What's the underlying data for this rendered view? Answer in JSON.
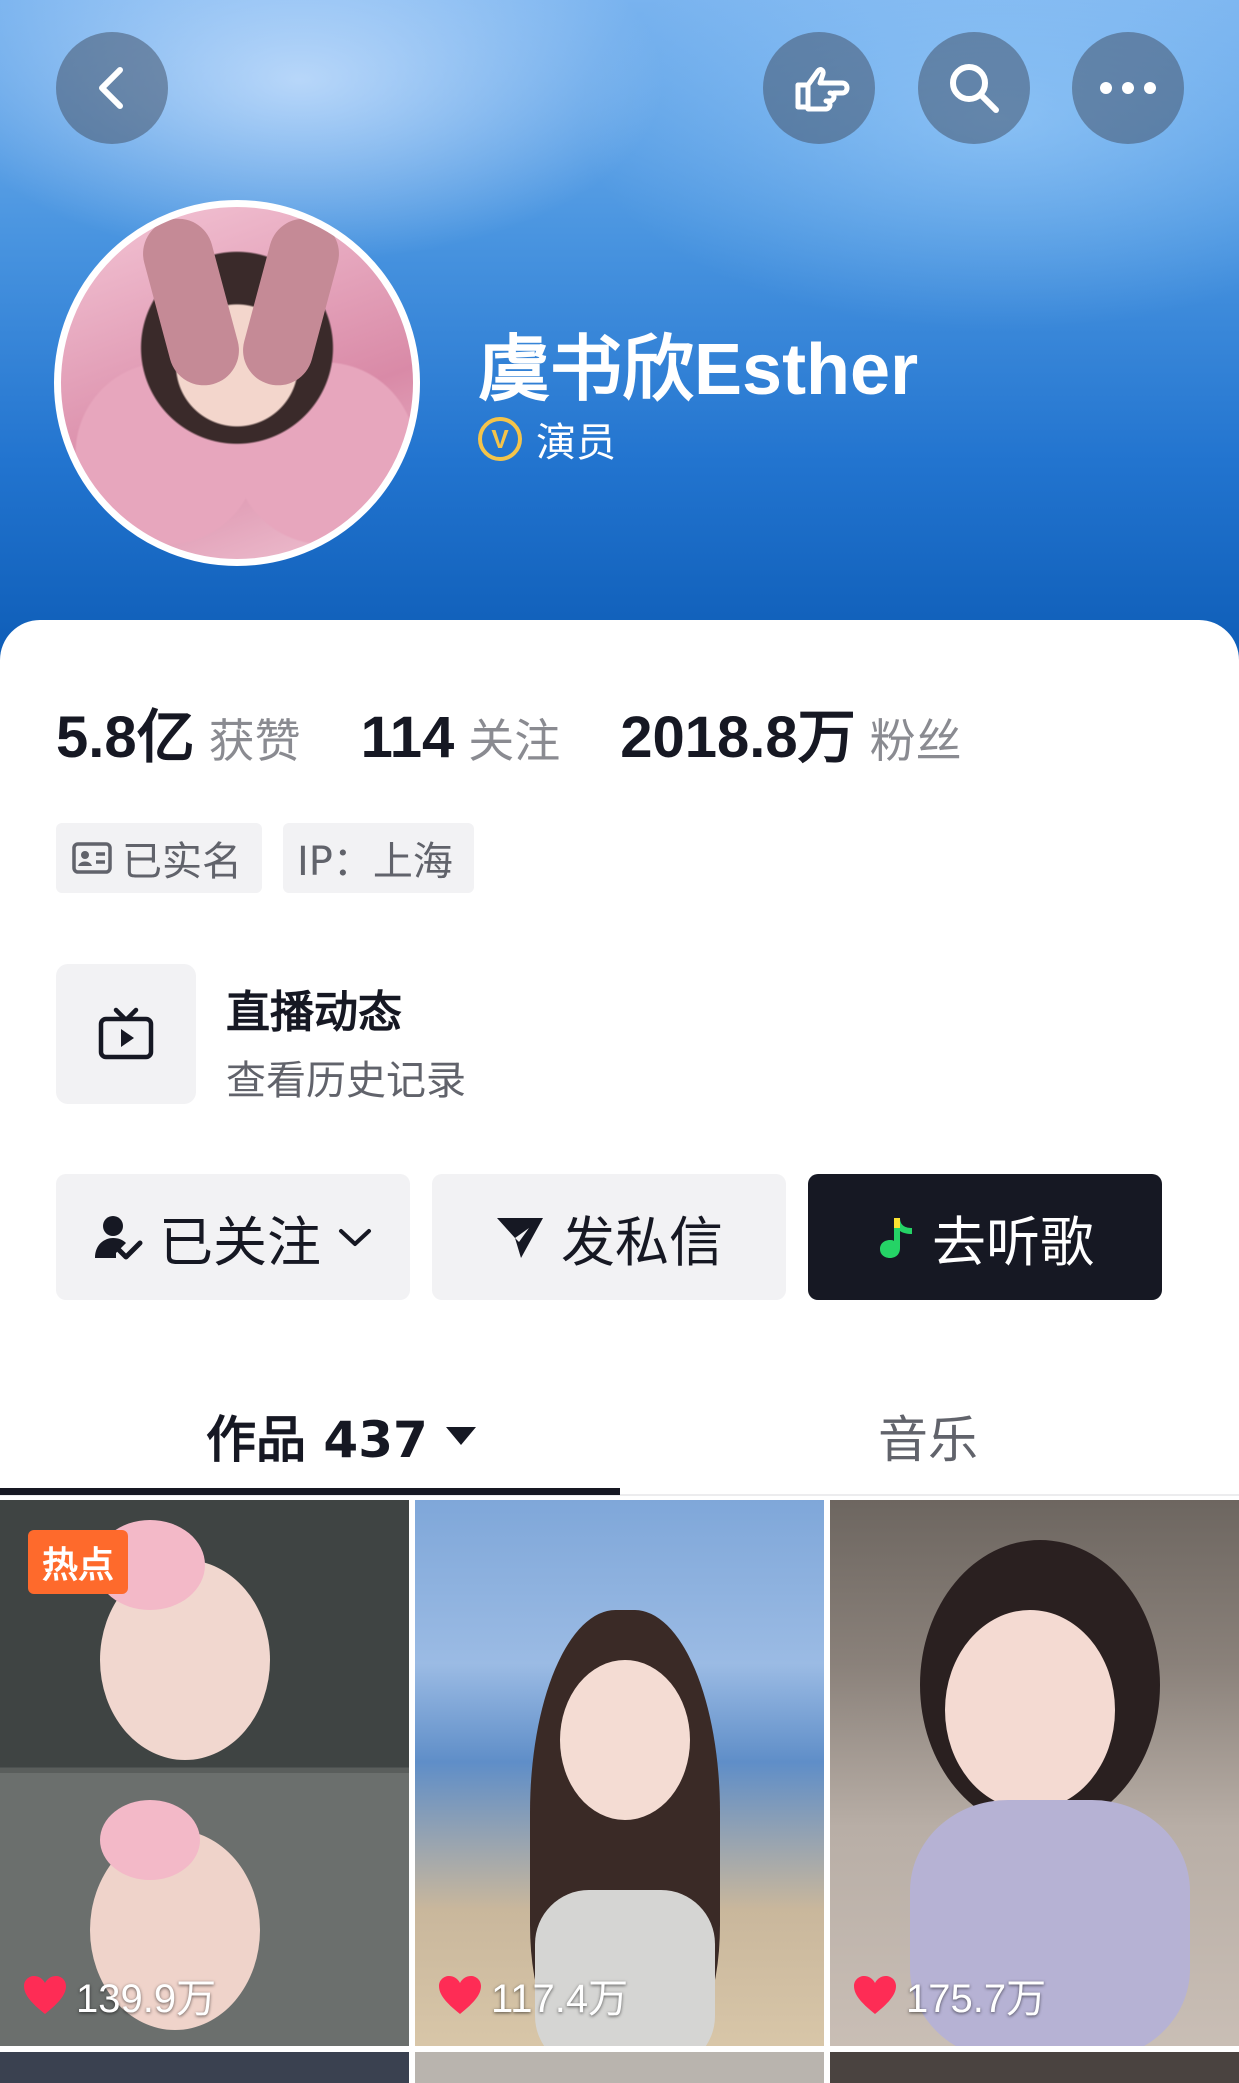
{
  "profile": {
    "name": "虞书欣Esther",
    "verification": "演员"
  },
  "stats": [
    {
      "value": "5.8亿",
      "label": "获赞"
    },
    {
      "value": "114",
      "label": "关注"
    },
    {
      "value": "2018.8万",
      "label": "粉丝"
    }
  ],
  "tags": {
    "realname": "已实名",
    "ip": "IP：上海"
  },
  "live": {
    "title": "直播动态",
    "subtitle": "查看历史记录"
  },
  "actions": {
    "follow": "已关注",
    "message": "发私信",
    "music": "去听歌"
  },
  "tabs": {
    "works": "作品 437",
    "music": "音乐"
  },
  "grid": [
    {
      "badge": "热点",
      "likes": "139.9万"
    },
    {
      "badge": "",
      "likes": "117.4万"
    },
    {
      "badge": "",
      "likes": "175.7万"
    }
  ],
  "colors": {
    "accent_dark": "#161823",
    "hot_badge": "#fe6a2c",
    "heart": "#fe2c55",
    "verify_gold": "#f4c44a"
  },
  "icons": [
    "back-icon",
    "gesture-icon",
    "search-icon",
    "more-icon",
    "id-card-icon",
    "tv-icon",
    "user-check-icon",
    "chevron-down-icon",
    "send-icon",
    "music-note-icon",
    "caret-down-icon",
    "heart-icon"
  ]
}
